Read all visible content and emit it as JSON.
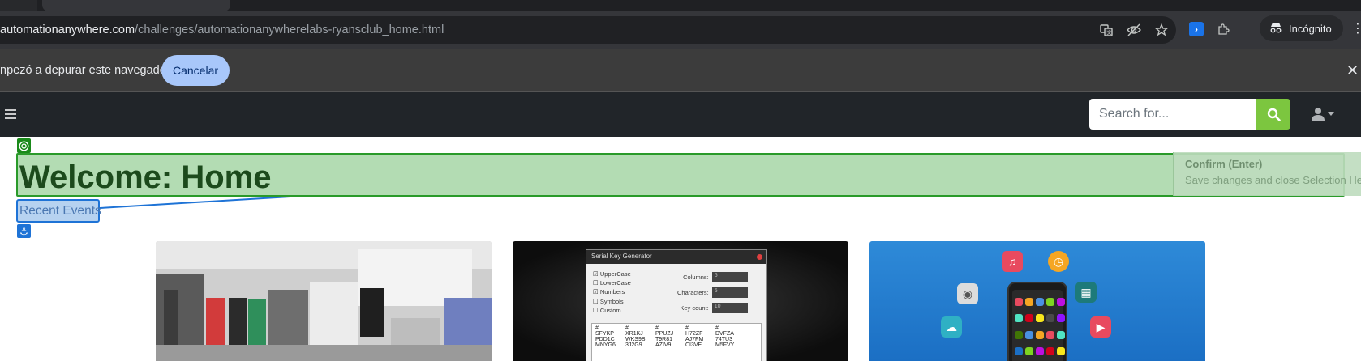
{
  "browser": {
    "url_host": "automationanywhere.com",
    "url_path": "/challenges/automationanywherelabs-ryansclub_home.html",
    "incognito_label": "Incógnito"
  },
  "infobar": {
    "message": "npezó a depurar este navegador",
    "cancel_label": "Cancelar"
  },
  "navbar": {
    "search_placeholder": "Search for..."
  },
  "page": {
    "heading": "Welcome: Home",
    "anchor_label": "Recent Events"
  },
  "selection_helper": {
    "confirm_title": "Confirm (Enter)",
    "confirm_subtitle": "Save changes and close Selection Helper."
  },
  "cards": {
    "serial_key": {
      "title": "Serial Key Generator",
      "options": [
        "UpperCase",
        "LowerCase",
        "Numbers",
        "Symbols",
        "Custom"
      ],
      "options_checked": [
        true,
        false,
        true,
        false,
        false
      ],
      "fields": [
        {
          "label": "Columns:",
          "value": "5"
        },
        {
          "label": "Characters:",
          "value": "5"
        },
        {
          "label": "Key count:",
          "value": "10"
        }
      ],
      "table_header": [
        "#",
        "#",
        "#",
        "#",
        "#"
      ],
      "table_rows": [
        [
          "SFYKP",
          "XR1KJ",
          "PPUZJ",
          "H72ZF",
          "DVFZA"
        ],
        [
          "PDD1C",
          "WKS9B",
          "T9R81",
          "AJ7FM",
          "74TU3"
        ],
        [
          "MNYG6",
          "3J2G9",
          "AZIV9",
          "CI3VE",
          "M5FVY"
        ]
      ]
    }
  }
}
